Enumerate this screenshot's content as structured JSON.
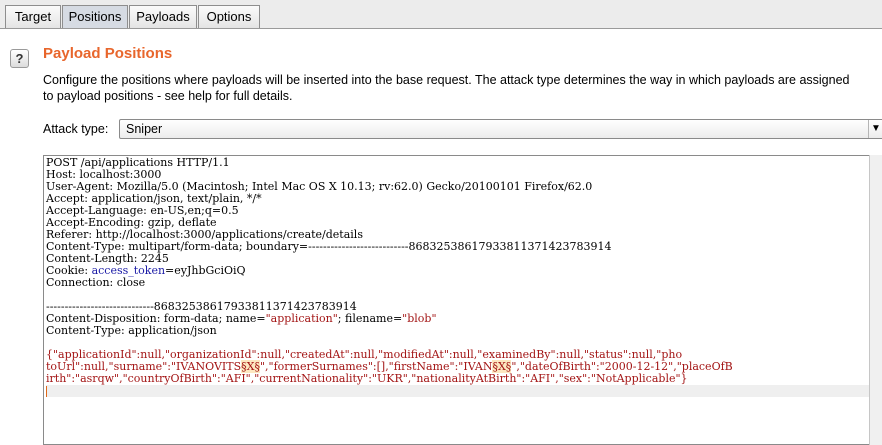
{
  "tabs": [
    {
      "label": "Target",
      "active": false
    },
    {
      "label": "Positions",
      "active": true
    },
    {
      "label": "Payloads",
      "active": false
    },
    {
      "label": "Options",
      "active": false
    }
  ],
  "section": {
    "help_glyph": "?",
    "title": "Payload Positions",
    "description_line1": "Configure the positions where payloads will be inserted into the base request. The attack type determines the way in which payloads are assigned",
    "description_line2": "to payload positions - see help for full details."
  },
  "attack": {
    "label": "Attack type:",
    "value": "Sniper",
    "arrow": "▼"
  },
  "request": {
    "l01": "POST /api/applications HTTP/1.1",
    "l02": "Host: localhost:3000",
    "l03": "User-Agent: Mozilla/5.0 (Macintosh; Intel Mac OS X 10.13; rv:62.0) Gecko/20100101 Firefox/62.0",
    "l04": "Accept: application/json, text/plain, */*",
    "l05": "Accept-Language: en-US,en;q=0.5",
    "l06": "Accept-Encoding: gzip, deflate",
    "l07": "Referer: http://localhost:3000/applications/create/details",
    "l08": "Content-Type: multipart/form-data; boundary=---------------------------86832538617933811371423783914",
    "l09": "Content-Length: 2245",
    "l10_key": "Cookie: ",
    "l10_cookie_name": "access_token",
    "l10_cookie_val": "=eyJhbGciOiQ",
    "l11": "Connection: close",
    "l13": "-----------------------------86832538617933811371423783914",
    "l14_a": "Content-Disposition: form-data; name=",
    "l14_b": "\"application\"",
    "l14_c": "; filename=",
    "l14_d": "\"blob\"",
    "l15": "Content-Type: application/json",
    "b1_a": "{\"applicationId\":null,\"organizationId\":null,\"createdAt\":null,\"modifiedAt\":null,\"examinedBy\":null,\"status\":null,\"pho",
    "b2_a": "toUrl\":null,\"surname\":\"IVANOVITS",
    "b2_m": "§X§",
    "b2_b": "\",\"formerSurnames\":[],\"firstName\":\"IVAN",
    "b2_m2": "§X§",
    "b2_c": "\",\"dateOfBirth\":\"2000-12-12\",\"placeOfB",
    "b3_a": "irth\":\"asrqw\",\"countryOfBirth\":\"AFI\",\"currentNationality\":\"UKR\",\"nationalityAtBirth\":\"AFI\",\"sex\":\"NotApplicable\"}"
  }
}
